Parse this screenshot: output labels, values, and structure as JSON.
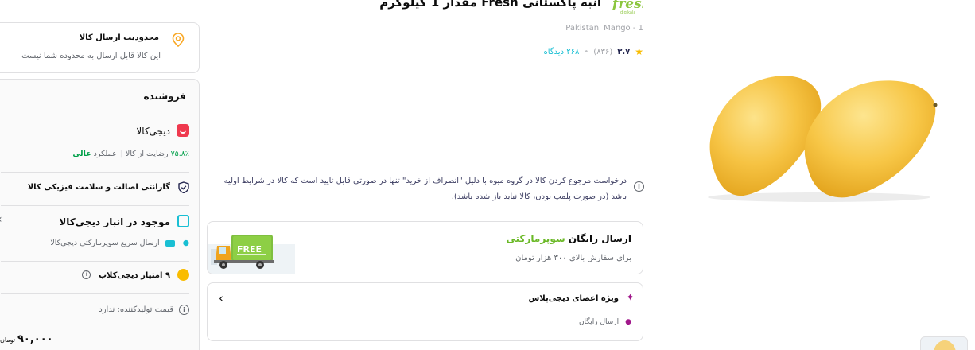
{
  "product": {
    "title": "انبه پاکستانی Fresh مقدار 1 کیلوگرم",
    "subtitle": "Pakistani Mango - 1",
    "brand_logo_text": "fresh",
    "rating": "۳.۷",
    "rating_count": "(۸۳۶)",
    "views": "۲۶۸ دیدگاه"
  },
  "return_note": "درخواست مرجوع کردن کالا در گروه میوه با دلیل \"انصراف از خرید\" تنها در صورتی قابل تایید است که کالا در شرایط اولیه باشد (در صورت پلمپ بودن، کالا نباید باز شده باشد).",
  "shipping": {
    "title_prefix": "ارسال رایگان",
    "title_highlight": "سوپرمارکتی",
    "subtitle": "برای سفارش بالای ۳۰۰ هزار تومان",
    "badge": "FREE"
  },
  "digiplus": {
    "title": "ویژه اعضای دیجی‌پلاس",
    "item": "ارسال رایگان"
  },
  "delivery_limit": {
    "title": "محدودیت ارسال کالا",
    "text": "این کالا قابل ارسال به محدوده شما نیست"
  },
  "seller": {
    "heading": "فروشنده",
    "name": "دیجی‌کالا",
    "satisfaction_value": "۷۵.۸٪",
    "satisfaction_label": "رضایت از کالا",
    "performance_label": "عملکرد",
    "performance_value": "عالی",
    "guarantee": "گارانتی اصالت و سلامت فیزیکی کالا",
    "stock": "موجود در انبار دیجی‌کالا",
    "fast_shipping": "ارسال سریع سوپرمارکتی دیجی‌کالا",
    "club_points": "۹ امتیاز دیجی‌کلاب",
    "producer_price": "قیمت تولیدکننده: ندارد",
    "price": "۹۰,۰۰۰",
    "currency": "تومان"
  },
  "colors": {
    "green": "#6bb927",
    "cyan": "#19bfd3",
    "brand_red": "#ef394e",
    "plus_purple": "#a1188b",
    "star": "#f9bc00"
  }
}
